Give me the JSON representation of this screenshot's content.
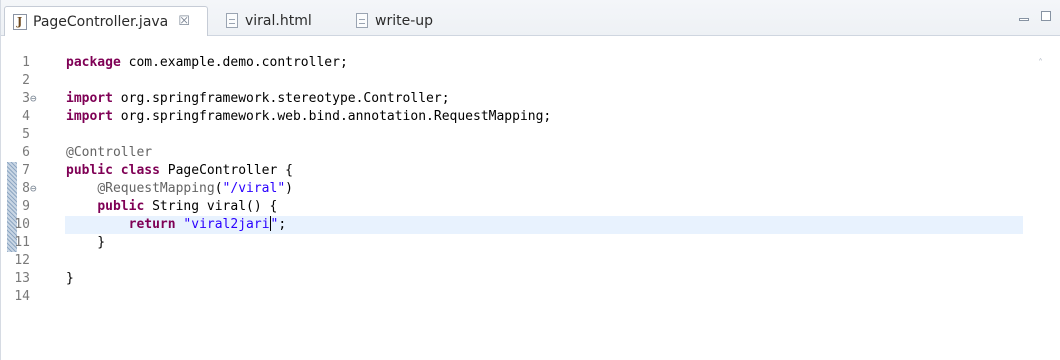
{
  "tabs": [
    {
      "label": "PageController.java",
      "icon": "java-file-icon",
      "active": true,
      "close": "☒"
    },
    {
      "label": "viral.html",
      "icon": "html-file-icon",
      "active": false
    },
    {
      "label": "write-up",
      "icon": "text-file-icon",
      "active": false
    }
  ],
  "window_controls": {
    "minimize": "minimize-icon",
    "maximize": "maximize-icon"
  },
  "editor": {
    "current_line": 10,
    "lines": [
      {
        "num": "1",
        "fold": "",
        "tokens": [
          {
            "t": "package",
            "c": "kw"
          },
          {
            "t": " com.example.demo.controller;",
            "c": ""
          }
        ]
      },
      {
        "num": "2",
        "fold": "",
        "tokens": []
      },
      {
        "num": "3",
        "fold": "⊖",
        "tokens": [
          {
            "t": "import",
            "c": "kw"
          },
          {
            "t": " org.springframework.stereotype.Controller;",
            "c": ""
          }
        ]
      },
      {
        "num": "4",
        "fold": "",
        "tokens": [
          {
            "t": "import",
            "c": "kw"
          },
          {
            "t": " org.springframework.web.bind.annotation.RequestMapping;",
            "c": ""
          }
        ]
      },
      {
        "num": "5",
        "fold": "",
        "tokens": []
      },
      {
        "num": "6",
        "fold": "",
        "tokens": [
          {
            "t": "@Controller",
            "c": "ann"
          }
        ]
      },
      {
        "num": "7",
        "fold": "",
        "tokens": [
          {
            "t": "public",
            "c": "kw"
          },
          {
            "t": " ",
            "c": ""
          },
          {
            "t": "class",
            "c": "kw"
          },
          {
            "t": " PageController {",
            "c": ""
          }
        ]
      },
      {
        "num": "8",
        "fold": "⊖",
        "tokens": [
          {
            "t": "    ",
            "c": ""
          },
          {
            "t": "@RequestMapping",
            "c": "ann"
          },
          {
            "t": "(",
            "c": ""
          },
          {
            "t": "\"/viral\"",
            "c": "str"
          },
          {
            "t": ")",
            "c": ""
          }
        ]
      },
      {
        "num": "9",
        "fold": "",
        "tokens": [
          {
            "t": "    ",
            "c": ""
          },
          {
            "t": "public",
            "c": "kw"
          },
          {
            "t": " String viral() {",
            "c": ""
          }
        ]
      },
      {
        "num": "10",
        "fold": "",
        "tokens": [
          {
            "t": "        ",
            "c": ""
          },
          {
            "t": "return",
            "c": "kw"
          },
          {
            "t": " ",
            "c": ""
          },
          {
            "t": "\"viral2jari",
            "c": "str"
          },
          {
            "t": "|",
            "c": "caret"
          },
          {
            "t": "\"",
            "c": "str"
          },
          {
            "t": ";",
            "c": ""
          }
        ]
      },
      {
        "num": "11",
        "fold": "",
        "tokens": [
          {
            "t": "    }",
            "c": ""
          }
        ]
      },
      {
        "num": "12",
        "fold": "",
        "tokens": []
      },
      {
        "num": "13",
        "fold": "",
        "tokens": [
          {
            "t": "}",
            "c": ""
          }
        ]
      },
      {
        "num": "14",
        "fold": "",
        "tokens": []
      }
    ]
  },
  "scroll_indicator": "˄"
}
